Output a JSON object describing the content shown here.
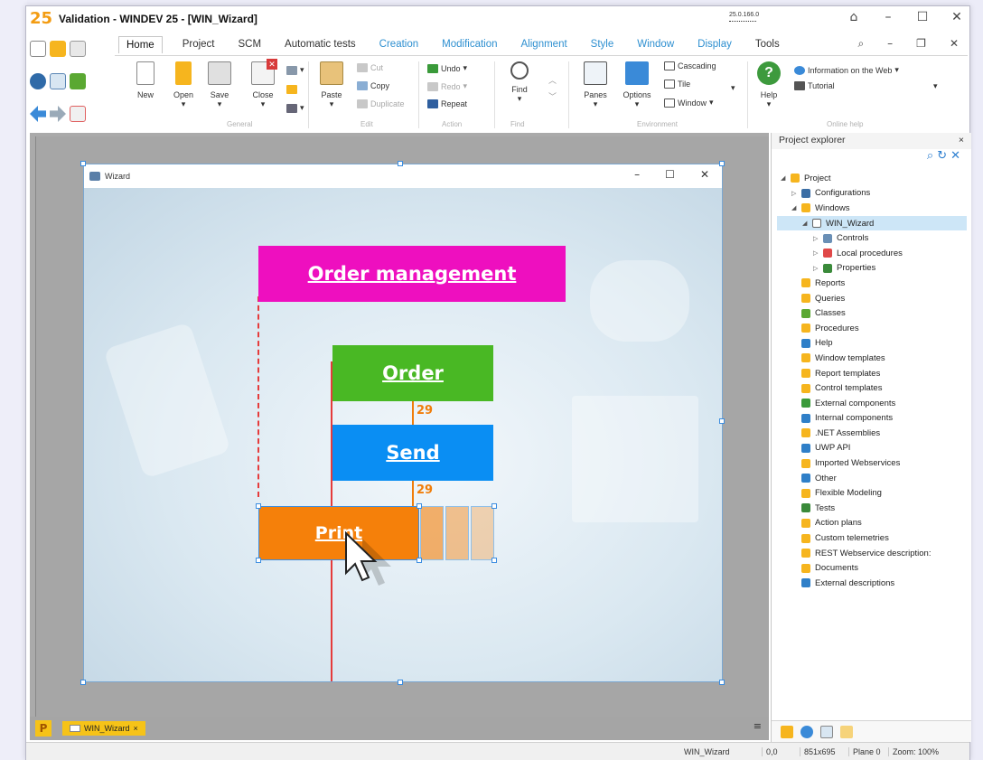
{
  "app": {
    "title": "Validation - WINDEV 25 - [WIN_Wizard]",
    "version": "25.0.166.0",
    "logo": "25"
  },
  "ribbon": {
    "tabs": [
      "Home",
      "Project",
      "SCM",
      "Automatic tests",
      "Creation",
      "Modification",
      "Alignment",
      "Style",
      "Window",
      "Display",
      "Tools"
    ],
    "active_tab": "Home",
    "buttons": {
      "new": "New",
      "open": "Open",
      "save": "Save",
      "close": "Close",
      "paste": "Paste",
      "cut": "Cut",
      "copy": "Copy",
      "duplicate": "Duplicate",
      "undo": "Undo",
      "redo": "Redo",
      "repeat": "Repeat",
      "find": "Find",
      "panes": "Panes",
      "options": "Options",
      "cascading": "Cascading",
      "tile": "Tile",
      "window": "Window",
      "help": "Help",
      "info_web": "Information on the Web",
      "tutorial": "Tutorial"
    },
    "groups": {
      "general": "General",
      "edit": "Edit",
      "action": "Action",
      "find": "Find",
      "environment": "Environment",
      "online_help": "Online help"
    }
  },
  "wizard": {
    "window_title": "Wizard",
    "cards": {
      "order_management": "Order management",
      "order": "Order",
      "send": "Send",
      "print": "Print"
    },
    "gap_1": "29",
    "gap_2": "29"
  },
  "bottom_tabs": {
    "project_tag": "P",
    "doc_tab": "WIN_Wizard",
    "doc_close": "×"
  },
  "status": {
    "name": "WIN_Wizard",
    "coords": "0,0",
    "size": "851x695",
    "plane": "Plane 0",
    "zoom": "Zoom: 100%"
  },
  "explorer": {
    "title": "Project explorer",
    "close": "×",
    "tree": [
      {
        "label": "Project",
        "level": 0,
        "toggle": "◢",
        "color": "#f6b51e"
      },
      {
        "label": "Configurations",
        "level": 1,
        "toggle": "▷",
        "color": "#3b6ea5"
      },
      {
        "label": "Windows",
        "level": 1,
        "toggle": "◢",
        "color": "#f6b51e"
      },
      {
        "label": "WIN_Wizard",
        "level": 2,
        "toggle": "◢",
        "color": "#ffffff",
        "selected": true
      },
      {
        "label": "Controls",
        "level": 3,
        "toggle": "▷",
        "color": "#6a8fb5"
      },
      {
        "label": "Local procedures",
        "level": 3,
        "toggle": "▷",
        "color": "#e04848"
      },
      {
        "label": "Properties",
        "level": 3,
        "toggle": "▷",
        "color": "#3a8a3a"
      },
      {
        "label": "Reports",
        "level": 1,
        "toggle": "",
        "color": "#f6b51e"
      },
      {
        "label": "Queries",
        "level": 1,
        "toggle": "",
        "color": "#f6b51e"
      },
      {
        "label": "Classes",
        "level": 1,
        "toggle": "",
        "color": "#5aa832"
      },
      {
        "label": "Procedures",
        "level": 1,
        "toggle": "",
        "color": "#f6b51e"
      },
      {
        "label": "Help",
        "level": 1,
        "toggle": "",
        "color": "#2f7fc8"
      },
      {
        "label": "Window templates",
        "level": 1,
        "toggle": "",
        "color": "#f6b51e"
      },
      {
        "label": "Report templates",
        "level": 1,
        "toggle": "",
        "color": "#f6b51e"
      },
      {
        "label": "Control templates",
        "level": 1,
        "toggle": "",
        "color": "#f6b51e"
      },
      {
        "label": "External components",
        "level": 1,
        "toggle": "",
        "color": "#3a9a3a"
      },
      {
        "label": "Internal components",
        "level": 1,
        "toggle": "",
        "color": "#2f7fc8"
      },
      {
        "label": ".NET Assemblies",
        "level": 1,
        "toggle": "",
        "color": "#f6b51e"
      },
      {
        "label": "UWP API",
        "level": 1,
        "toggle": "",
        "color": "#2f7fc8"
      },
      {
        "label": "Imported Webservices",
        "level": 1,
        "toggle": "",
        "color": "#f6b51e"
      },
      {
        "label": "Other",
        "level": 1,
        "toggle": "",
        "color": "#2f7fc8"
      },
      {
        "label": "Flexible Modeling",
        "level": 1,
        "toggle": "",
        "color": "#f6b51e"
      },
      {
        "label": "Tests",
        "level": 1,
        "toggle": "",
        "color": "#3a8a3a"
      },
      {
        "label": "Action plans",
        "level": 1,
        "toggle": "",
        "color": "#f6b51e"
      },
      {
        "label": "Custom telemetries",
        "level": 1,
        "toggle": "",
        "color": "#f6b51e"
      },
      {
        "label": "REST Webservice description:",
        "level": 1,
        "toggle": "",
        "color": "#f6b51e"
      },
      {
        "label": "Documents",
        "level": 1,
        "toggle": "",
        "color": "#f6b51e"
      },
      {
        "label": "External descriptions",
        "level": 1,
        "toggle": "",
        "color": "#2f7fc8"
      }
    ]
  },
  "colors": {
    "magenta": "#ee0fbf",
    "green": "#49b824",
    "blue": "#0a8ef3",
    "orange": "#f5800a",
    "accent": "#2d8fd0"
  }
}
